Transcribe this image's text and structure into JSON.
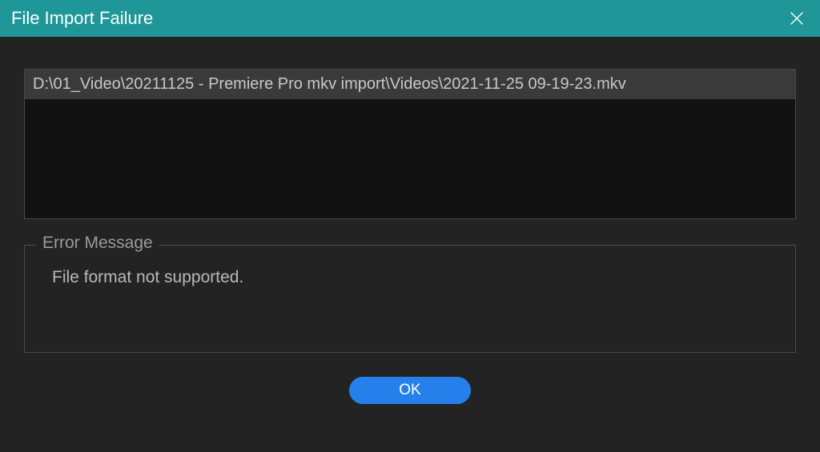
{
  "dialog": {
    "title": "File Import Failure",
    "file_list": {
      "items": [
        "D:\\01_Video\\20211125 - Premiere Pro mkv import\\Videos\\2021-11-25 09-19-23.mkv"
      ]
    },
    "error": {
      "legend": "Error Message",
      "text": "File format not supported."
    },
    "buttons": {
      "ok_label": "OK"
    }
  }
}
